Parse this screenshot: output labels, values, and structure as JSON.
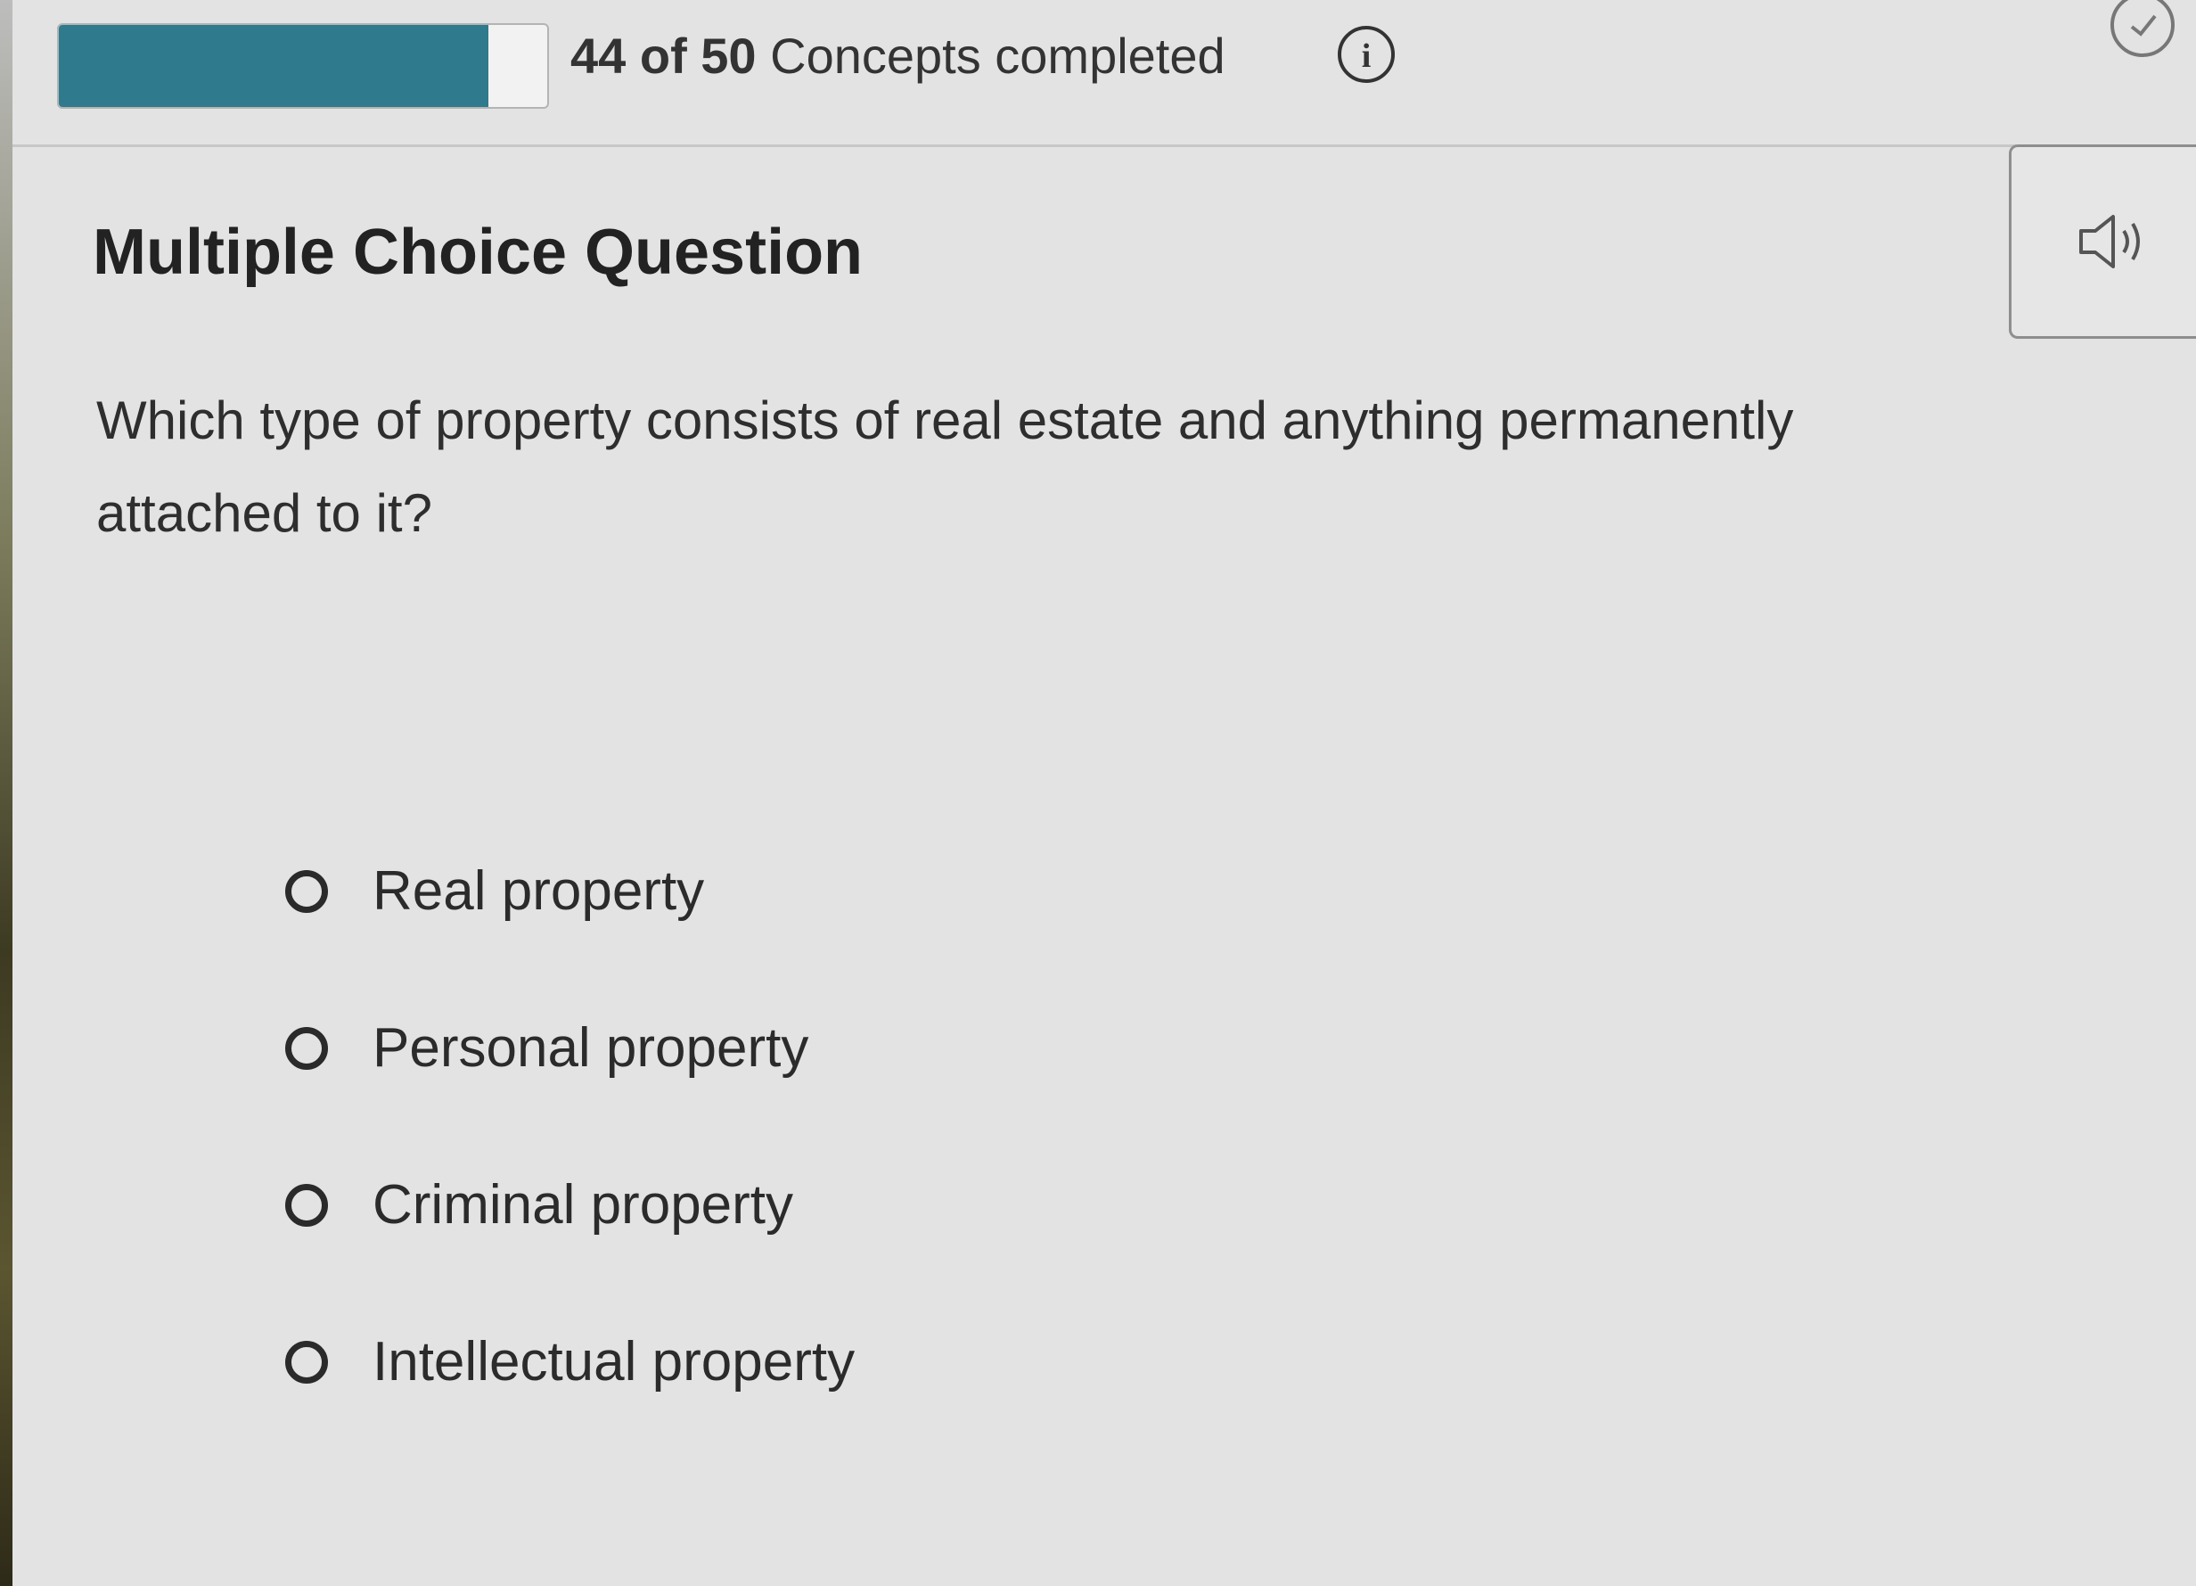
{
  "progress": {
    "completed": "44",
    "of_word": "of",
    "total": "50",
    "suffix": "Concepts completed",
    "fraction": 0.88,
    "bar_color": "#2f7a8c"
  },
  "icons": {
    "info": "info-icon",
    "check": "check-circle-icon",
    "speaker": "speaker-icon",
    "info_glyph": "i"
  },
  "question": {
    "title": "Multiple Choice Question",
    "prompt": "Which type of property consists of real estate and anything permanently attached to it?"
  },
  "options": [
    {
      "label": "Real property"
    },
    {
      "label": "Personal property"
    },
    {
      "label": "Criminal property"
    },
    {
      "label": "Intellectual property"
    }
  ]
}
